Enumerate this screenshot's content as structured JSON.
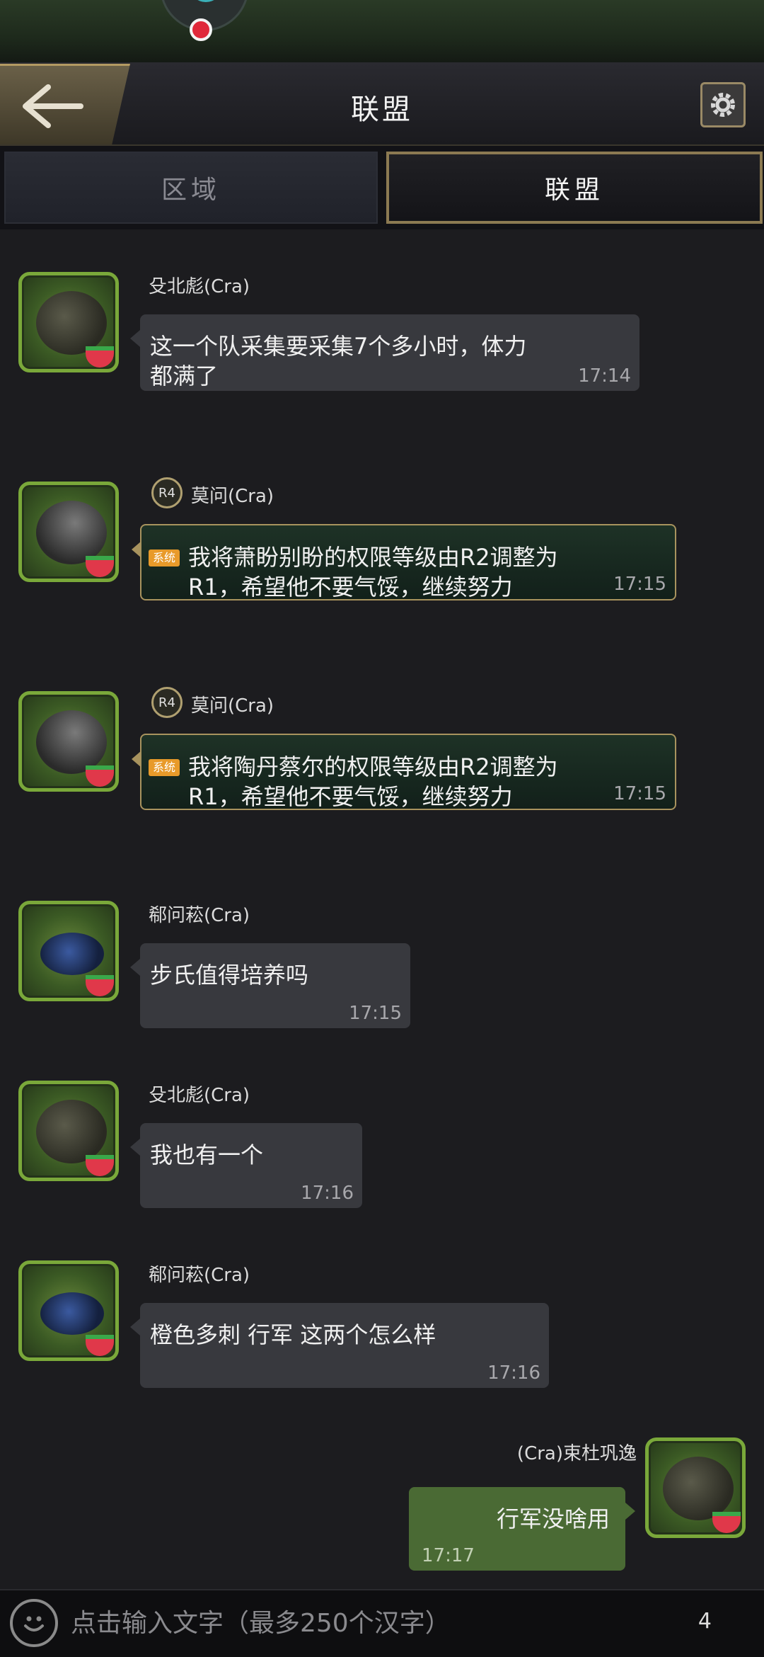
{
  "header": {
    "title": "联盟"
  },
  "tabs": [
    {
      "label": "区域",
      "active": false
    },
    {
      "label": "联盟",
      "active": true
    }
  ],
  "messages": [
    {
      "sender": "殳北彪(Cra)",
      "text": "这一个队采集要采集7个多小时，体力都满了",
      "time": "17:14",
      "system": false,
      "avatar": "spider-icon"
    },
    {
      "sender": "莫问(Cra)",
      "rank": "R4",
      "tag": "系统",
      "text": "我将萧盼别盼的权限等级由R2调整为R1，希望他不要气馁，继续努力",
      "time": "17:15",
      "system": true,
      "avatar": "beetle-icon"
    },
    {
      "sender": "莫问(Cra)",
      "rank": "R4",
      "tag": "系统",
      "text": "我将陶丹蔡尔的权限等级由R2调整为R1，希望他不要气馁，继续努力",
      "time": "17:15",
      "system": true,
      "avatar": "beetle-icon"
    },
    {
      "sender": "郗问菘(Cra)",
      "text": "步氏值得培养吗",
      "time": "17:15",
      "system": false,
      "avatar": "ant-icon"
    },
    {
      "sender": "殳北彪(Cra)",
      "text": "我也有一个",
      "time": "17:16",
      "system": false,
      "avatar": "spider-icon"
    },
    {
      "sender": "郗问菘(Cra)",
      "text": "橙色多刺  行军 这两个怎么样",
      "time": "17:16",
      "system": false,
      "avatar": "ant-icon"
    },
    {
      "sender": "(Cra)束杜巩逸",
      "text": "行军没啥用",
      "time": "17:17",
      "mine": true,
      "avatar": "spider-icon"
    }
  ],
  "input": {
    "placeholder": "点击输入文字（最多250个汉字）",
    "count": "4"
  },
  "colors": {
    "system_border": "#a8935e",
    "mine_bubble": "#4a6a34",
    "bubble": "#38393e",
    "system_tag": "#e89a2a"
  }
}
